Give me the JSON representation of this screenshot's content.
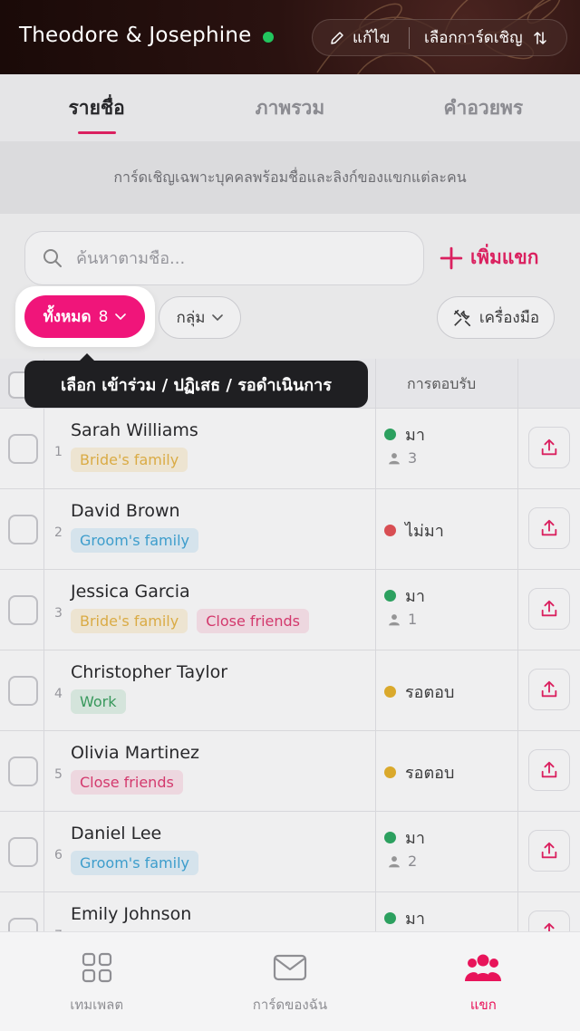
{
  "header": {
    "title": "Theodore & Josephine",
    "edit_label": "แก้ไข",
    "select_card_label": "เลือกการ์ดเชิญ"
  },
  "tabs": [
    {
      "label": "รายชื่อ",
      "active": true
    },
    {
      "label": "ภาพรวม",
      "active": false
    },
    {
      "label": "คำอวยพร",
      "active": false
    }
  ],
  "notice": "การ์ดเชิญเฉพาะบุคคลพร้อมชื่อและลิงก์ของแขกแต่ละคน",
  "search": {
    "placeholder": "ค้นหาตามชื่อ..."
  },
  "add_guest_label": "เพิ่มแขก",
  "filters": {
    "all_label": "ทั้งหมด",
    "all_count": "8",
    "group_label": "กลุ่ม",
    "tools_label": "เครื่องมือ"
  },
  "tooltip": "เลือก เข้าร่วม / ปฏิเสธ / รอดำเนินการ",
  "table": {
    "rsvp_header": "การตอบรับ",
    "rows": [
      {
        "num": "1",
        "name": "Sarah Williams",
        "tags": [
          {
            "label": "Bride's family",
            "kind": "bride"
          }
        ],
        "status": "มา",
        "status_color": "#22a55a",
        "count": "3"
      },
      {
        "num": "2",
        "name": "David Brown",
        "tags": [
          {
            "label": "Groom's family",
            "kind": "groom"
          }
        ],
        "status": "ไม่มา",
        "status_color": "#e5484d",
        "count": ""
      },
      {
        "num": "3",
        "name": "Jessica Garcia",
        "tags": [
          {
            "label": "Bride's family",
            "kind": "bride"
          },
          {
            "label": "Close friends",
            "kind": "friends"
          }
        ],
        "status": "มา",
        "status_color": "#22a55a",
        "count": "1"
      },
      {
        "num": "4",
        "name": "Christopher Taylor",
        "tags": [
          {
            "label": "Work",
            "kind": "work"
          }
        ],
        "status": "รอตอบ",
        "status_color": "#e8b020",
        "count": ""
      },
      {
        "num": "5",
        "name": "Olivia Martinez",
        "tags": [
          {
            "label": "Close friends",
            "kind": "friends"
          }
        ],
        "status": "รอตอบ",
        "status_color": "#e8b020",
        "count": ""
      },
      {
        "num": "6",
        "name": "Daniel Lee",
        "tags": [
          {
            "label": "Groom's family",
            "kind": "groom"
          }
        ],
        "status": "มา",
        "status_color": "#22a55a",
        "count": "2"
      },
      {
        "num": "7",
        "name": "Emily Johnson",
        "tags": [],
        "status": "มา",
        "status_color": "#22a55a",
        "count": ""
      }
    ]
  },
  "bottom_nav": [
    {
      "label": "เทมเพลต",
      "icon": "grid-icon",
      "active": false
    },
    {
      "label": "การ์ดของฉัน",
      "icon": "envelope-icon",
      "active": false
    },
    {
      "label": "แขก",
      "icon": "people-icon",
      "active": true
    }
  ],
  "colors": {
    "accent": "#e8145a",
    "chip_pink": "#f0157a"
  }
}
